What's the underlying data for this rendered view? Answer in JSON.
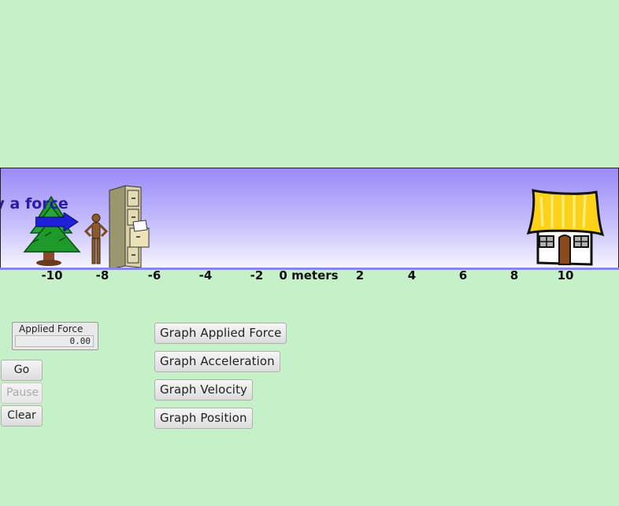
{
  "scene": {
    "instruction": "ly a force",
    "axis": {
      "unit_label": "0 meters",
      "ticks": [
        "-10",
        "-8",
        "-6",
        "-4",
        "-2",
        "2",
        "4",
        "6",
        "8",
        "10"
      ]
    }
  },
  "controls": {
    "applied_force_label": "Applied Force",
    "applied_force_value": "0.00",
    "go": "Go",
    "pause": "Pause",
    "clear": "Clear"
  },
  "graph_buttons": {
    "applied_force": "Graph Applied Force",
    "acceleration": "Graph Acceleration",
    "velocity": "Graph Velocity",
    "position": "Graph Position"
  },
  "colors": {
    "background": "#c6f0c8",
    "sky_top": "#9a8af8",
    "instruction_text": "#2a1aa8",
    "arrow": "#2020d8"
  }
}
